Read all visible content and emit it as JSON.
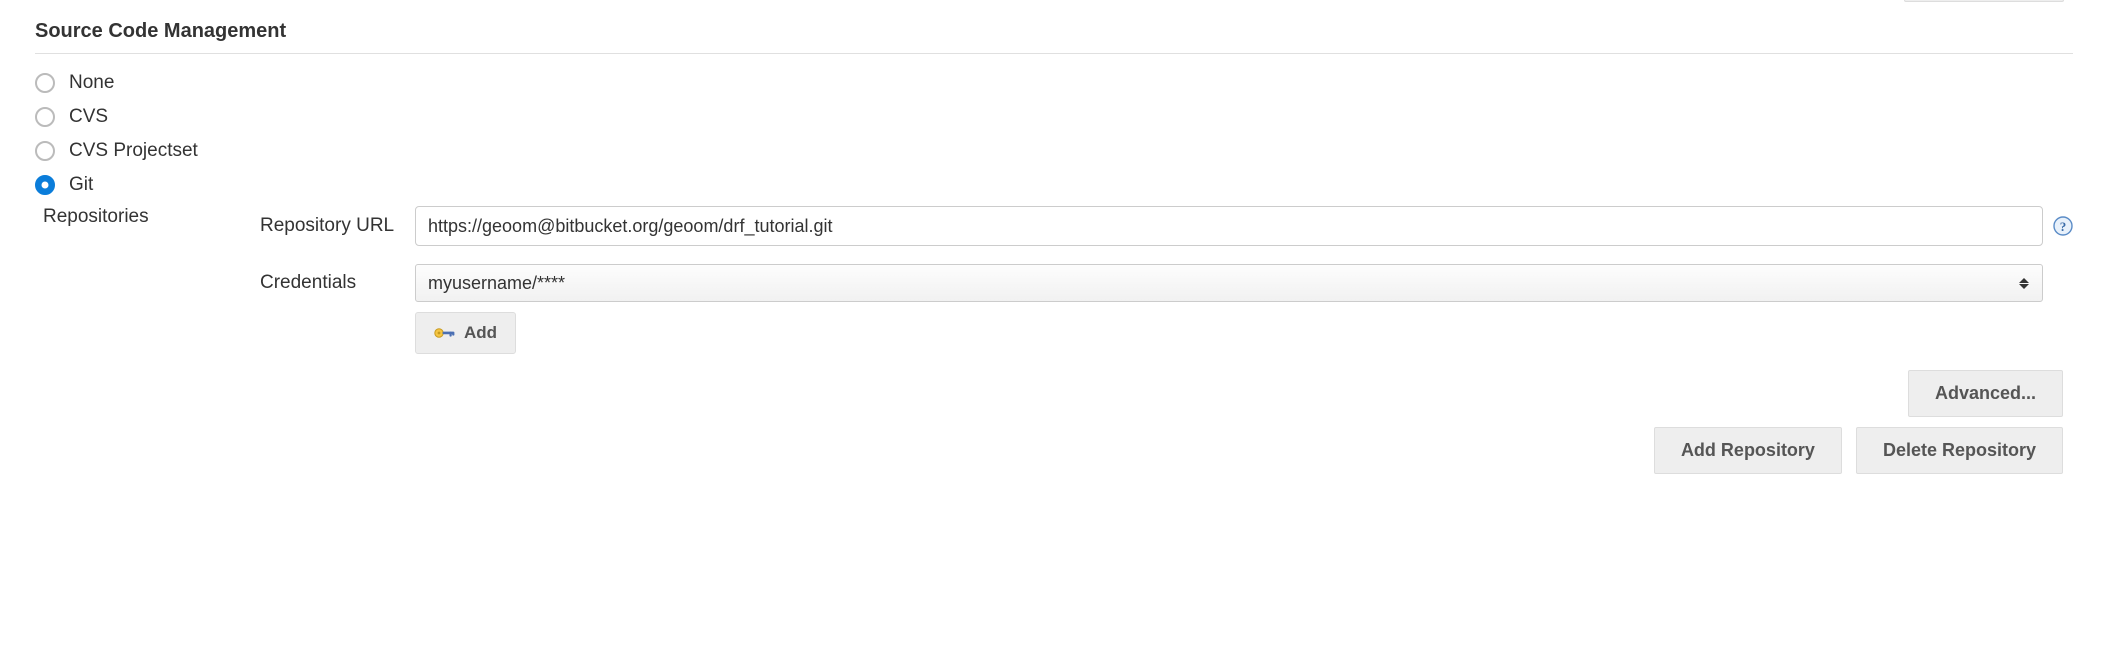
{
  "section": {
    "title": "Source Code Management"
  },
  "scm_options": [
    {
      "label": "None",
      "selected": false
    },
    {
      "label": "CVS",
      "selected": false
    },
    {
      "label": "CVS Projectset",
      "selected": false
    },
    {
      "label": "Git",
      "selected": true
    }
  ],
  "git": {
    "repositories_label": "Repositories",
    "repo_url_label": "Repository URL",
    "repo_url_value": "https://geoom@bitbucket.org/geoom/drf_tutorial.git",
    "credentials_label": "Credentials",
    "credentials_value": "myusername/****",
    "add_label": "Add",
    "advanced_label": "Advanced...",
    "add_repo_label": "Add Repository",
    "delete_repo_label": "Delete Repository"
  }
}
